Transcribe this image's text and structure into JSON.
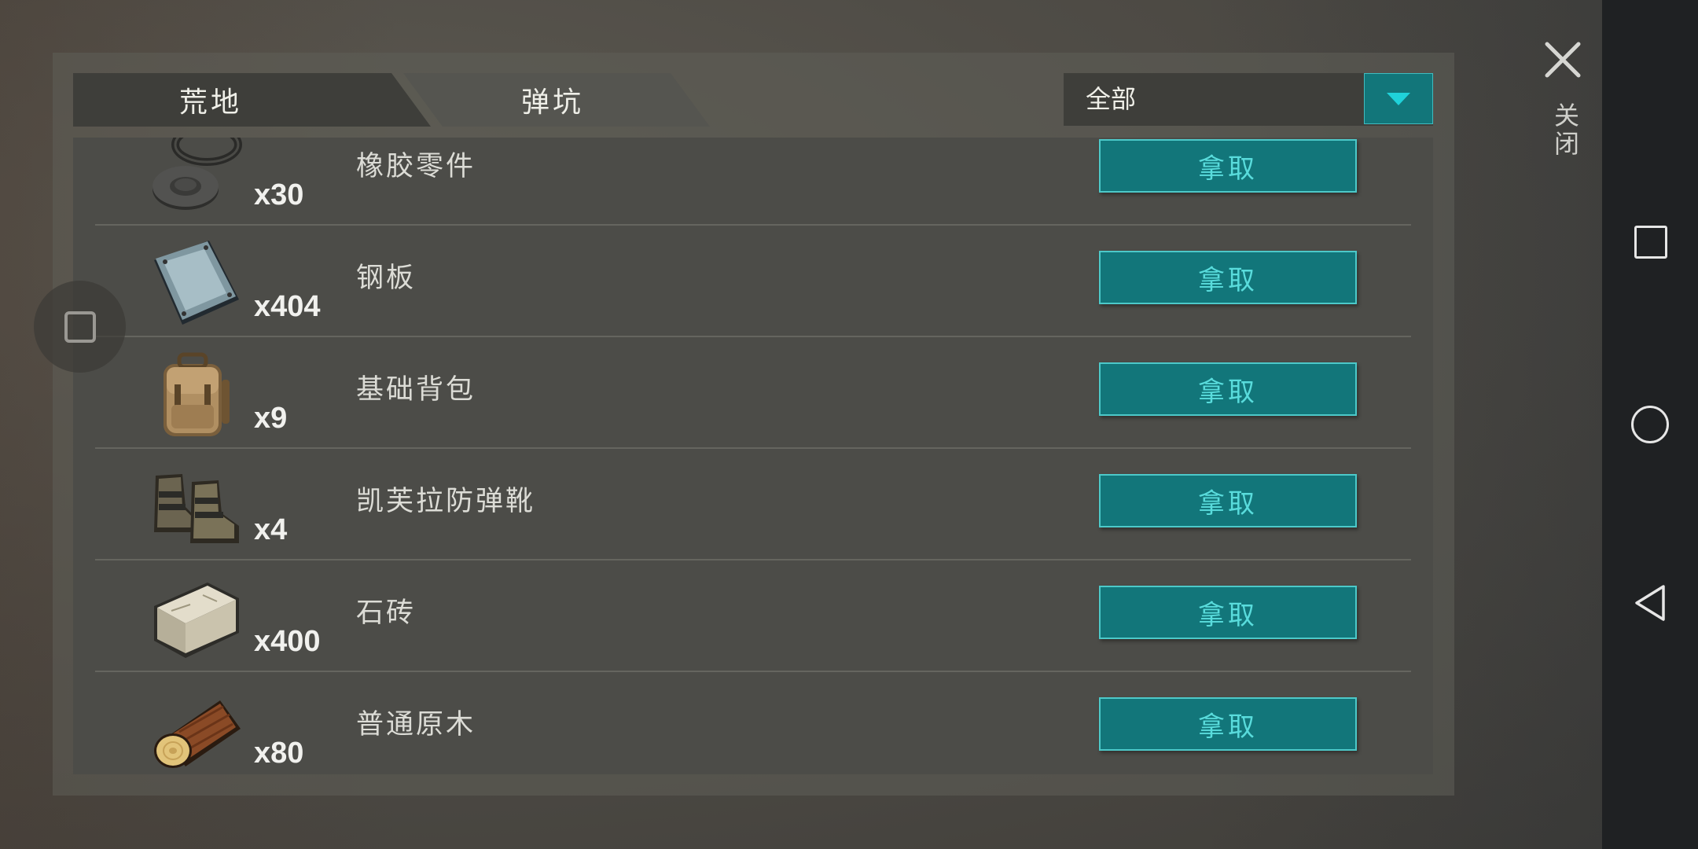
{
  "tabs": [
    {
      "label": "荒地",
      "active": true
    },
    {
      "label": "弹坑",
      "active": false
    }
  ],
  "filter": {
    "selected": "全部"
  },
  "items": [
    {
      "name": "橡胶零件",
      "qty": "x30",
      "icon": "rubber-parts-icon",
      "action": "拿取"
    },
    {
      "name": "钢板",
      "qty": "x404",
      "icon": "steel-plate-icon",
      "action": "拿取"
    },
    {
      "name": "基础背包",
      "qty": "x9",
      "icon": "backpack-icon",
      "action": "拿取"
    },
    {
      "name": "凯芙拉防弹靴",
      "qty": "x4",
      "icon": "kevlar-boots-icon",
      "action": "拿取"
    },
    {
      "name": "石砖",
      "qty": "x400",
      "icon": "stone-brick-icon",
      "action": "拿取"
    },
    {
      "name": "普通原木",
      "qty": "x80",
      "icon": "log-icon",
      "action": "拿取"
    }
  ],
  "close_label": "关闭",
  "colors": {
    "accent": "#12767a",
    "accent_text": "#59dcdc",
    "accent_border": "#4cc9c9"
  }
}
